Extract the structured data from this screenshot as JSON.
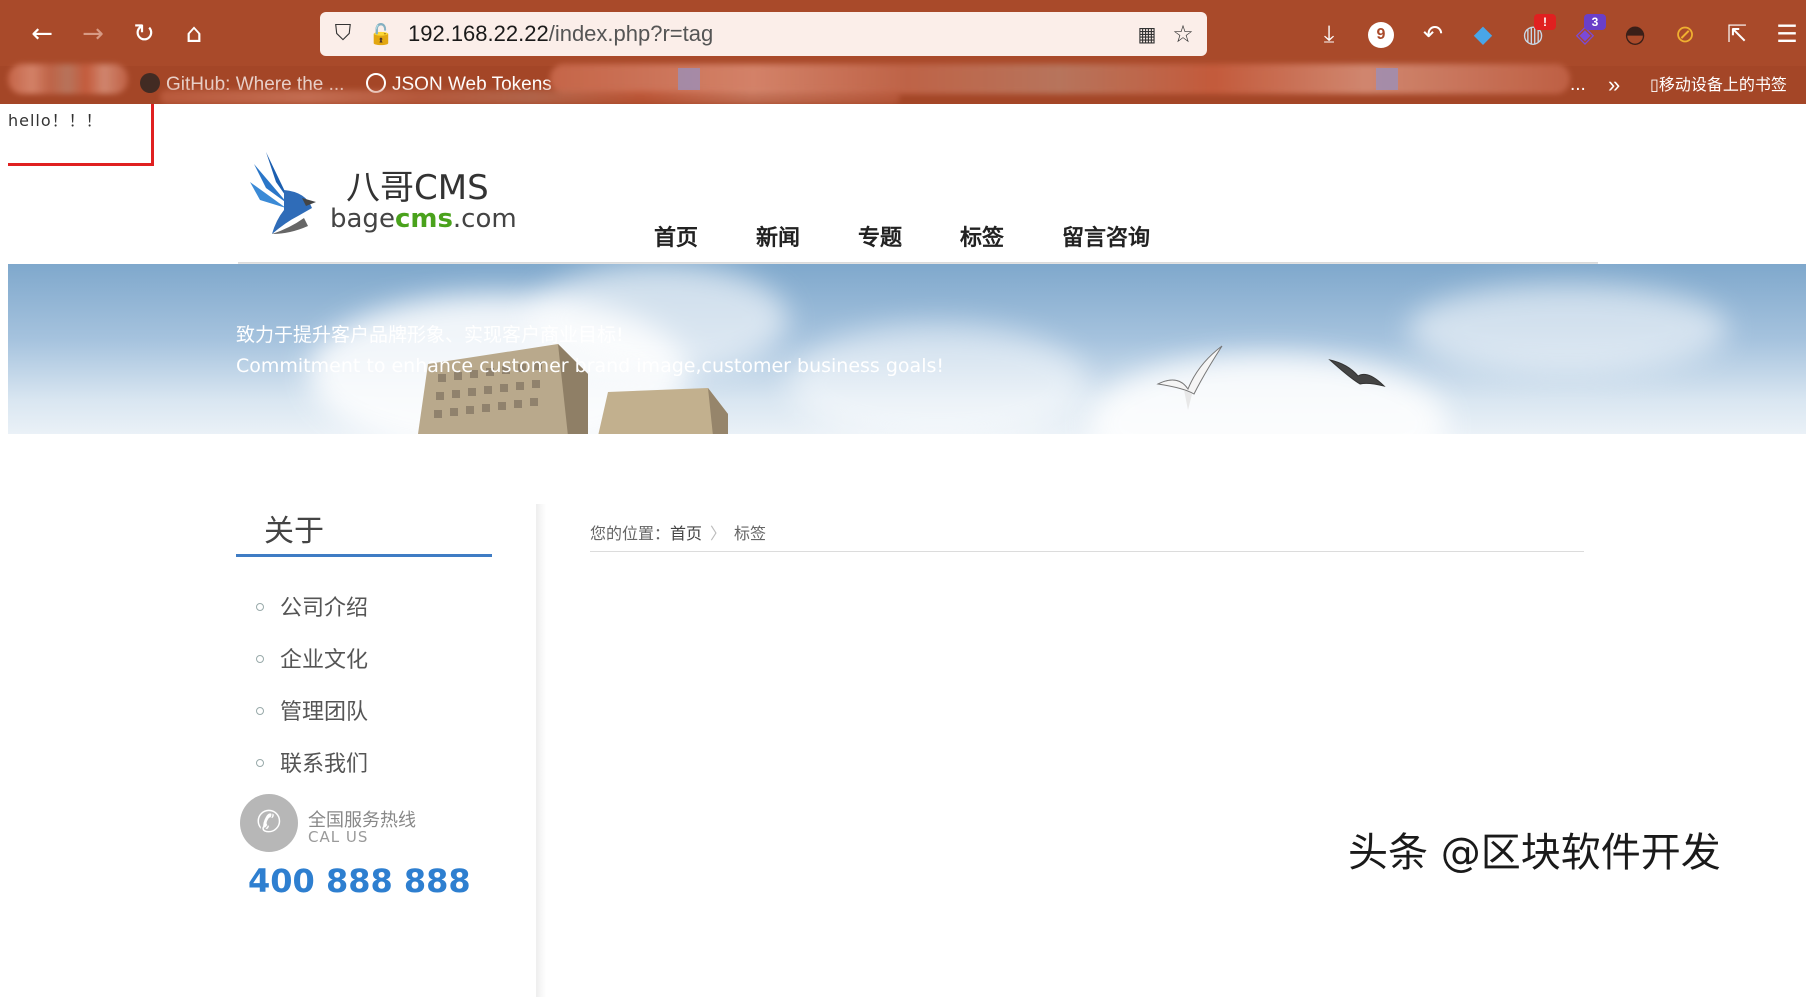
{
  "browser": {
    "url_host": "192.168.22.22",
    "url_path": "/index.php?r=tag",
    "extension_badge_count": "9",
    "extension_badge_alert": "!",
    "extension_badge_three": "3",
    "bookmarks": [
      {
        "label": "GitHub: Where the ..."
      },
      {
        "label": "JSON Web Tokens"
      },
      {
        "label": "..."
      }
    ],
    "mobile_bookmarks_label": "移动设备上的书签",
    "colors": {
      "toolbar": "#a94a2a",
      "urlbar": "#fbeee9"
    }
  },
  "page": {
    "hello_text": "hello！！！",
    "logo": {
      "cn": "八哥CMS",
      "en_prefix": "bage",
      "en_mid": "cms",
      "en_suffix": ".com"
    },
    "nav": [
      "首页",
      "新闻",
      "专题",
      "标签",
      "留言咨询"
    ],
    "banner": {
      "cn": "致力于提升客户品牌形象、实现客户商业目标!",
      "en": "Commitment to enhance customer brand image,customer business goals!"
    },
    "sidebar": {
      "title": "关于",
      "items": [
        "公司介绍",
        "企业文化",
        "管理团队",
        "联系我们"
      ],
      "hotline_cn": "全国服务热线",
      "hotline_en": "CAL US",
      "hotline_number": "400 888 888",
      "accent_color": "#3f7cc4"
    },
    "breadcrumb": {
      "prefix": "您的位置：",
      "home": "首页",
      "separator": "〉",
      "current": "标签"
    },
    "watermark": "头条 @区块软件开发"
  }
}
